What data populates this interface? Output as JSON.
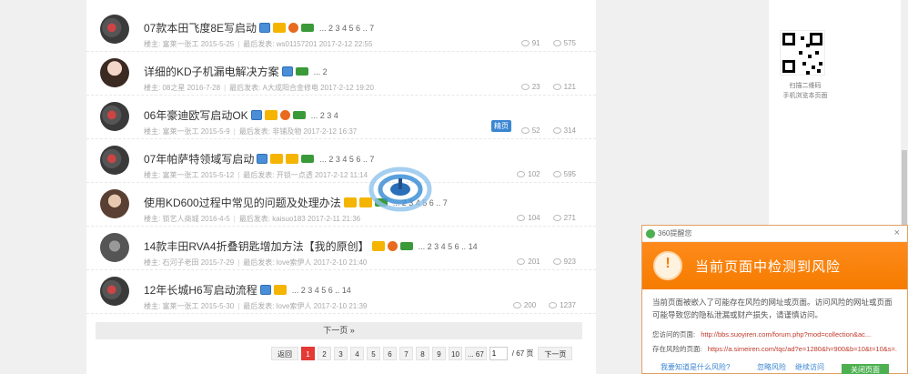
{
  "threads": [
    {
      "title": "07款本田飞度8E写启动",
      "pages": "... 2 3 4 5 6 .. 7",
      "author_label": "楼主:",
      "author": "富莱一张工",
      "date": "2015-5-25",
      "last_label": "最后发表:",
      "last": "ws01157201 2017-2-12 22:55",
      "replies": "91",
      "views": "575",
      "avatar": "car",
      "icons": [
        "img",
        "hot",
        "rec",
        "new"
      ]
    },
    {
      "title": "详细的KD子机漏电解决方案",
      "pages": "... 2",
      "author_label": "楼主:",
      "author": "08之星",
      "date": "2016-7-28",
      "last_label": "最后发表:",
      "last": "A大成阳合金修电 2017-2-12 19:20",
      "replies": "23",
      "views": "121",
      "avatar": "girl",
      "icons": [
        "img",
        "new"
      ]
    },
    {
      "title": "06年豪迪欧写启动OK",
      "pages": "... 2 3 4",
      "author_label": "楼主:",
      "author": "富莱一张工",
      "date": "2015-5-9",
      "last_label": "最后发表:",
      "last": "非铺及物 2017-2-12 16:37",
      "replies": "52",
      "views": "314",
      "avatar": "car",
      "icons": [
        "img",
        "hot",
        "rec",
        "new"
      ],
      "tag": "精页"
    },
    {
      "title": "07年帕萨特领域写启动",
      "pages": "... 2 3 4 5 6 .. 7",
      "author_label": "楼主:",
      "author": "富莱一张工",
      "date": "2015-5-12",
      "last_label": "最后发表:",
      "last": "开锁一点透 2017-2-12 11:14",
      "replies": "102",
      "views": "595",
      "avatar": "car",
      "icons": [
        "img",
        "hot",
        "hot",
        "new"
      ]
    },
    {
      "title": "使用KD600过程中常见的问题及处理办法",
      "pages": "... 2 3 4 5 6 .. 7",
      "author_label": "楼主:",
      "author": "锁艺人商城",
      "date": "2016-4-5",
      "last_label": "最后发表:",
      "last": "kaisuo183 2017-2-11 21:36",
      "replies": "104",
      "views": "271",
      "avatar": "face",
      "icons": [
        "hot",
        "hot",
        "new"
      ]
    },
    {
      "title": "14款丰田RVA4折叠钥匙增加方法【我的原创】",
      "pages": "... 2 3 4 5 6 .. 14",
      "author_label": "楼主:",
      "author": "石河子老田",
      "date": "2015-7-29",
      "last_label": "最后发表:",
      "last": "love索伊人 2017-2-10 21:40",
      "replies": "201",
      "views": "923",
      "avatar": "gray",
      "icons": [
        "hot",
        "rec",
        "new"
      ]
    },
    {
      "title": "12年长城H6写启动流程",
      "pages": "... 2 3 4 5 6 .. 14",
      "author_label": "楼主:",
      "author": "富莱一张工",
      "date": "2015-5-30",
      "last_label": "最后发表:",
      "last": "love索伊人 2017-2-10 21:39",
      "replies": "200",
      "views": "1237",
      "avatar": "car",
      "icons": [
        "img",
        "hot"
      ]
    }
  ],
  "next_page": "下一页 »",
  "pager": {
    "back": "返回",
    "pages": [
      "1",
      "2",
      "3",
      "4",
      "5",
      "6",
      "7",
      "8",
      "9",
      "10",
      "... 67"
    ],
    "active": "1",
    "input_value": "1",
    "total": "/ 67 页",
    "next": "下一页"
  },
  "qr": {
    "line1": "扫描二维码",
    "line2": "手机浏览本页面"
  },
  "popup": {
    "header": "360提醒您",
    "close": "×",
    "title": "当前页面中检测到风险",
    "body": "当前页面被嵌入了可能存在风险的网址或页面。访问风险的网址或页面可能导致您的隐私泄漏或财产损失，请谨慎访问。",
    "visit_label": "您访问的页面:",
    "visit_url": "http://bbs.suoyiren.com/forum.php?mod=collection&ac...",
    "risk_label": "存在风险的页面:",
    "risk_url": "https://a.simeiren.com/tqc/ad?e=1280&h=900&b=10&t=10&s=...",
    "foot_link1": "我要知道是什么风险?",
    "foot_link2": "忽略风险",
    "foot_link3": "继续访问",
    "close_button": "关闭页面"
  }
}
